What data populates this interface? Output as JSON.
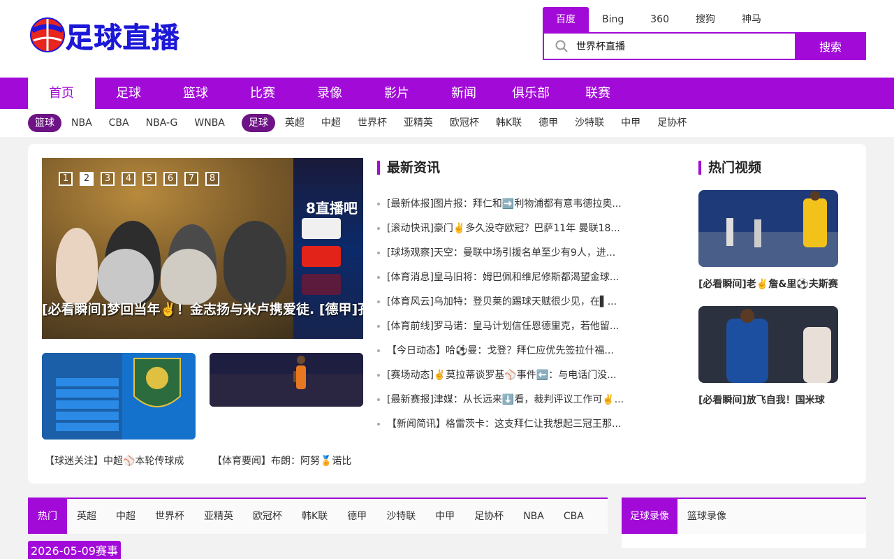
{
  "header": {
    "logo_text": "足球直播",
    "engines": [
      "百度",
      "Bing",
      "360",
      "搜狗",
      "神马"
    ],
    "active_engine": 0,
    "search_value": "世界杯直播",
    "search_button": "搜索"
  },
  "nav": {
    "items": [
      "首页",
      "足球",
      "篮球",
      "比赛",
      "录像",
      "影片",
      "新闻",
      "俱乐部",
      "联赛"
    ],
    "active": 0
  },
  "subnav": {
    "basketball_label": "篮球",
    "basketball_items": [
      "NBA",
      "CBA",
      "NBA-G",
      "WNBA"
    ],
    "football_label": "足球",
    "football_items": [
      "英超",
      "中超",
      "世界杯",
      "亚精英",
      "欧冠杯",
      "韩K联",
      "德甲",
      "沙特联",
      "中甲",
      "足协杯"
    ]
  },
  "slider": {
    "pages": [
      "1",
      "2",
      "3",
      "4",
      "5",
      "6",
      "7",
      "8"
    ],
    "active_page": 1,
    "caption": "[必看瞬间]梦回当年✌️！金志扬与米卢携爱徒.  [德甲]孔帕",
    "watermark": "8直播吧"
  },
  "thumbs": [
    {
      "caption": "【球迷关注】中超⚾本轮传球成"
    },
    {
      "caption": "【体育要闻】布朗：阿努🏅诺比"
    }
  ],
  "news": {
    "title": "最新资讯",
    "items": [
      "[最新体报]图片报：拜仁和➡️利物浦都有意韦德拉奥...",
      "[滚动快讯]豪门✌️多久没夺欧冠？巴萨11年 曼联18...",
      "[球场观察]天空：曼联中场引援名单至少有9人，进...",
      "[体育消息]皇马旧将：姆巴佩和维尼修斯都渴望金球...",
      "[体育风云]乌加特：登贝莱的踢球天赋很少见，在▌...",
      "[体育前线]罗马诺：皇马计划信任恩德里克，若他留...",
      "【今日动态】哈⚽曼：戈登？拜仁应优先签拉什福...",
      "[赛场动态]✌️莫拉蒂谈罗基⚾事件⬅️：与电话门没...",
      "[最新赛报]津媒：从长远来⬇️看，裁判评议工作可✌️...",
      "【新闻简讯】格雷茨卡：这支拜仁让我想起三冠王那..."
    ]
  },
  "videos": {
    "title": "热门视频",
    "items": [
      {
        "caption": "[必看瞬间]老✌️詹&里⚽夫斯赛"
      },
      {
        "caption": "[必看瞬间]放飞自我！国米球"
      }
    ]
  },
  "schedule": {
    "tabs": [
      "热门",
      "英超",
      "中超",
      "世界杯",
      "亚精英",
      "欧冠杯",
      "韩K联",
      "德甲",
      "沙特联",
      "中甲",
      "足协杯",
      "NBA",
      "CBA"
    ],
    "active_tab": 0,
    "date_label": "2026-05-09赛事"
  },
  "replay": {
    "tabs": [
      "足球录像",
      "篮球录像"
    ],
    "active_tab": 0
  },
  "colors": {
    "brand": "#a20ad8",
    "category_pill": "#6e1386"
  }
}
